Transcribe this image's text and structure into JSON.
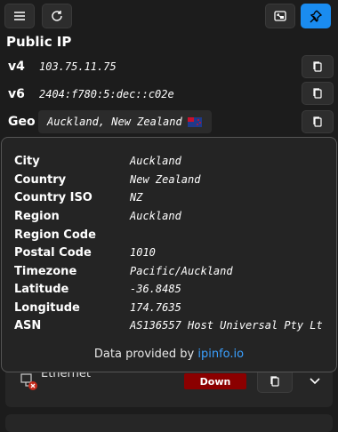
{
  "toolbar": {
    "menu_icon": "hamburger-menu-icon",
    "refresh_icon": "refresh-icon",
    "window_icon": "snap-window-icon",
    "pin_icon": "pin-icon",
    "accent": "#1a8cf0"
  },
  "public_ip": {
    "title": "Public IP",
    "rows": [
      {
        "label": "v4",
        "value": "103.75.11.75"
      },
      {
        "label": "v6",
        "value": "2404:f780:5:dec::c02e"
      },
      {
        "label": "Geo",
        "value": "Auckland, New Zealand"
      }
    ]
  },
  "geo_details": {
    "fields": [
      {
        "key": "City",
        "value": "Auckland"
      },
      {
        "key": "Country",
        "value": "New Zealand"
      },
      {
        "key": "Country ISO",
        "value": "NZ"
      },
      {
        "key": "Region",
        "value": "Auckland"
      },
      {
        "key": "Region Code",
        "value": ""
      },
      {
        "key": "Postal Code",
        "value": "1010"
      },
      {
        "key": "Timezone",
        "value": "Pacific/Auckland"
      },
      {
        "key": "Latitude",
        "value": "-36.8485"
      },
      {
        "key": "Longitude",
        "value": "174.7635"
      },
      {
        "key": "ASN",
        "value": "AS136557 Host Universal Pty Lt"
      }
    ],
    "credit_prefix": "Data provided by ",
    "credit_link": "ipinfo.io"
  },
  "adapter": {
    "name": "Ethernet",
    "status": "Down",
    "status_color": "#8b0000"
  }
}
